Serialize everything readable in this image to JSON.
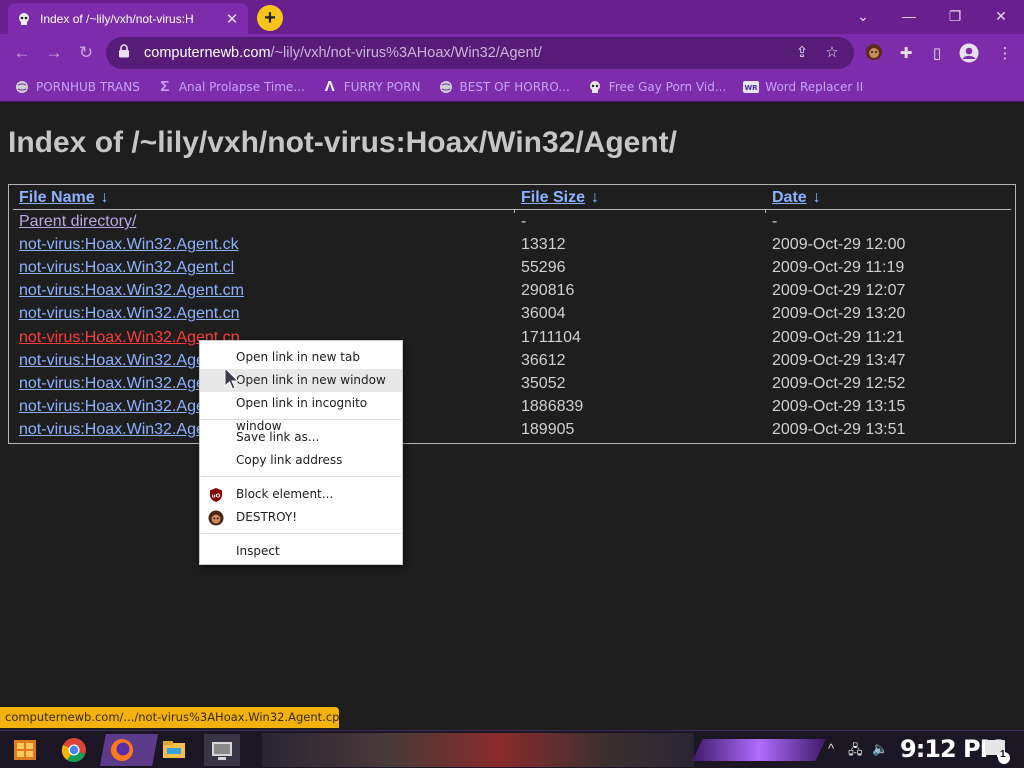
{
  "browser": {
    "tab": {
      "title": "Index of /~lily/vxh/not-virus:H",
      "close": "✕",
      "new_tab": "+"
    },
    "window_controls": {
      "minimize": "—",
      "restore": "❐",
      "close": "✕",
      "tabsearch": "⌄"
    },
    "address": {
      "host": "computernewb.com",
      "path": "/~lily/vxh/not-virus%3AHoax/Win32/Agent/"
    },
    "bookmarks": [
      {
        "label": "PORNHUB TRANS",
        "icon": "globe-icon"
      },
      {
        "label": "Anal Prolapse Time...",
        "icon": "sigma-icon"
      },
      {
        "label": "FURRY PORN",
        "icon": "lambda-icon"
      },
      {
        "label": "BEST OF HORRO...",
        "icon": "globe-icon"
      },
      {
        "label": "Free Gay Porn Vid...",
        "icon": "skull-icon"
      },
      {
        "label": "Word Replacer II",
        "icon": "wr-icon"
      }
    ],
    "accent": "#7d2cab"
  },
  "page": {
    "title": "Index of /~lily/vxh/not-virus:Hoax/Win32/Agent/",
    "columns": {
      "name": "File Name",
      "size": "File Size",
      "date": "Date",
      "sort_arrow": "↓"
    },
    "rows": [
      {
        "name": "Parent directory/",
        "size": "-",
        "date": "-"
      },
      {
        "name": "not-virus:Hoax.Win32.Agent.ck",
        "size": "13312",
        "date": "2009-Oct-29 12:00"
      },
      {
        "name": "not-virus:Hoax.Win32.Agent.cl",
        "size": "55296",
        "date": "2009-Oct-29 11:19"
      },
      {
        "name": "not-virus:Hoax.Win32.Agent.cm",
        "size": "290816",
        "date": "2009-Oct-29 12:07"
      },
      {
        "name": "not-virus:Hoax.Win32.Agent.cn",
        "size": "36004",
        "date": "2009-Oct-29 13:20"
      },
      {
        "name": "not-virus:Hoax.Win32.Agent.cp",
        "size": "1711104",
        "date": "2009-Oct-29 11:21"
      },
      {
        "name": "not-virus:Hoax.Win32.Agent.cq",
        "size": "36612",
        "date": "2009-Oct-29 13:47"
      },
      {
        "name": "not-virus:Hoax.Win32.Agent.cr",
        "size": "35052",
        "date": "2009-Oct-29 12:52"
      },
      {
        "name": "not-virus:Hoax.Win32.Agent.cs",
        "size": "1886839",
        "date": "2009-Oct-29 13:15"
      },
      {
        "name": "not-virus:Hoax.Win32.Agent.ct",
        "size": "189905",
        "date": "2009-Oct-29 13:51"
      }
    ]
  },
  "context_menu": {
    "items": [
      "Open link in new tab",
      "Open link in new window",
      "Open link in incognito window",
      "Save link as...",
      "Copy link address",
      "Block element...",
      "DESTROY!",
      "Inspect"
    ]
  },
  "status_bar": {
    "url": "computernewb.com/.../not-virus%3AHoax.Win32.Agent.cp"
  },
  "taskbar": {
    "clock": "9:12 PM",
    "notification_count": "1"
  }
}
